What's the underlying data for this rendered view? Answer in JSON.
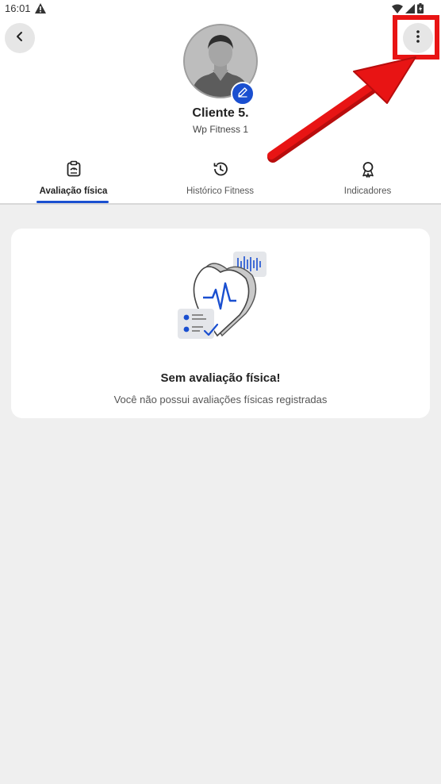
{
  "status_bar": {
    "time": "16:01"
  },
  "header": {
    "back_icon": "chevron-left-icon",
    "more_icon": "more-vertical-icon",
    "client_name": "Cliente 5.",
    "gym_name": "Wp Fitness 1",
    "edit_icon": "pencil-icon"
  },
  "tabs": [
    {
      "label": "Avaliação física",
      "icon": "scale-clipboard-icon",
      "active": true
    },
    {
      "label": "Histórico Fitness",
      "icon": "history-icon",
      "active": false
    },
    {
      "label": "Indicadores",
      "icon": "award-icon",
      "active": false
    }
  ],
  "empty_state": {
    "title": "Sem avaliação física!",
    "description": "Você não possui avaliações físicas registradas"
  },
  "colors": {
    "accent": "#1a4fd0",
    "annotation": "#e81414",
    "background": "#efefef"
  }
}
